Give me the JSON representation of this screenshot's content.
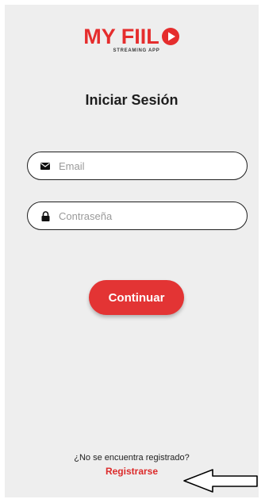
{
  "logo": {
    "text": "MY FIIL",
    "tagline": "STREAMING APP",
    "brand_color": "#e52d2d"
  },
  "title": "Iniciar Sesión",
  "email": {
    "placeholder": "Email",
    "value": "",
    "icon": "envelope-icon"
  },
  "password": {
    "placeholder": "Contraseña",
    "value": "",
    "icon": "lock-icon"
  },
  "continue_label": "Continuar",
  "footer": {
    "question": "¿No se encuentra registrado?",
    "register_label": "Registrarse"
  },
  "annotation": {
    "icon": "arrow-left-icon"
  }
}
